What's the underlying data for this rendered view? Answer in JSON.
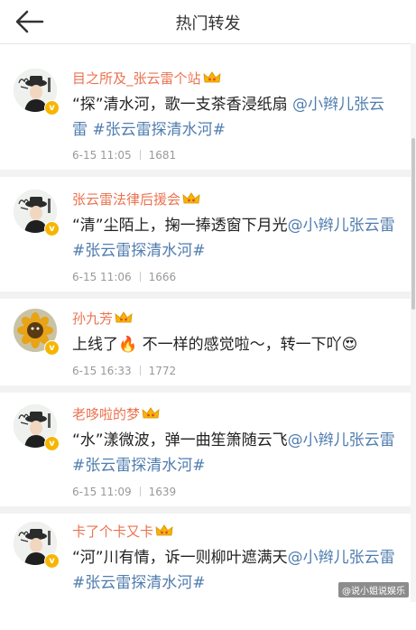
{
  "header": {
    "title": "热门转发"
  },
  "posts": [
    {
      "name": "目之所及_张云雷个站",
      "segments": [
        {
          "type": "text",
          "text": "“探”清水河，歌一支茶香浸纸扇 "
        },
        {
          "type": "mention",
          "text": "@小辫儿张云雷"
        },
        {
          "type": "text",
          "text": " "
        },
        {
          "type": "topic",
          "text": "#张云雷探清水河#"
        }
      ],
      "date": "6-15 11:05",
      "count": "1681"
    },
    {
      "name": "张云雷法律后援会",
      "segments": [
        {
          "type": "text",
          "text": "“清”尘陌上，掬一捧透窗下月光"
        },
        {
          "type": "mention",
          "text": "@小辫儿张云雷"
        },
        {
          "type": "text",
          "text": " "
        },
        {
          "type": "topic",
          "text": "#张云雷探清水河#"
        }
      ],
      "date": "6-15 11:06",
      "count": "1666"
    },
    {
      "name": "孙九芳",
      "segments": [
        {
          "type": "text",
          "text": "上线了🔥 不一样的感觉啦～，转一下吖😍"
        }
      ],
      "date": "6-15 16:33",
      "count": "1772"
    },
    {
      "name": "老哆啦的梦",
      "segments": [
        {
          "type": "text",
          "text": "“水”漾微波，弹一曲笙箫随云飞"
        },
        {
          "type": "mention",
          "text": "@小辫儿张云雷"
        },
        {
          "type": "text",
          "text": " "
        },
        {
          "type": "topic",
          "text": "#张云雷探清水河#"
        }
      ],
      "date": "6-15 11:09",
      "count": "1639"
    },
    {
      "name": "卡了个卡又卡",
      "segments": [
        {
          "type": "text",
          "text": "“河”川有情，诉一则柳叶遮满天"
        },
        {
          "type": "mention",
          "text": "@小辫儿张云雷"
        },
        {
          "type": "text",
          "text": " "
        },
        {
          "type": "topic",
          "text": "#张云雷探清水河#"
        }
      ],
      "date": "",
      "count": ""
    }
  ],
  "watermark": "@说小姐说娱乐",
  "colors": {
    "name": "#eb7350",
    "link": "#507daf",
    "meta": "#999999",
    "divider": "#f2f2f2",
    "badge": "#f7b500"
  },
  "icons": {
    "back": "back-arrow-icon",
    "crown": "vip-crown-icon",
    "verified": "verified-badge-icon"
  }
}
